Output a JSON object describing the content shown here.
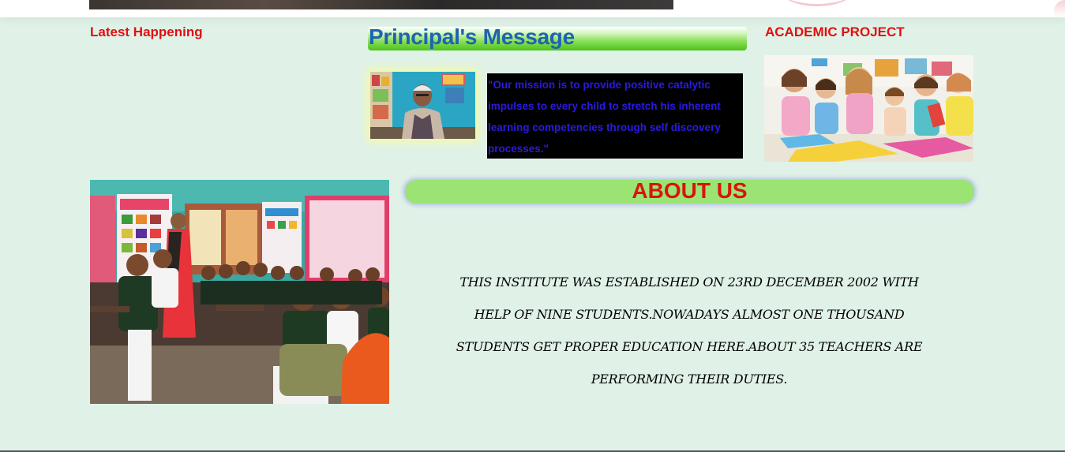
{
  "sections": {
    "latest_happening": "Latest Happening",
    "principal_message_title": "Principal's Message",
    "academic_project": "ACADEMIC PROJECT",
    "about_us_title": "ABOUT US"
  },
  "principal": {
    "quote": "\"Our mission is to provide positive catalytic impulses to every child to stretch his inherent learning competencies through self discovery processes.\""
  },
  "about": {
    "text": "THIS INSTITUTE WAS ESTABLISHED ON 23RD DECEMBER 2002 WITH HELP OF NINE STUDENTS.NOWADAYS ALMOST ONE THOUSAND STUDENTS GET PROPER EDUCATION HERE.ABOUT 35 TEACHERS ARE PERFORMING THEIR DUTIES."
  },
  "colors": {
    "page_bg": "#e0f2e8",
    "title_red": "#e01010",
    "principal_blue": "#1e63b3",
    "quote_text": "#2b1ae0",
    "about_bar": "#9be474"
  }
}
